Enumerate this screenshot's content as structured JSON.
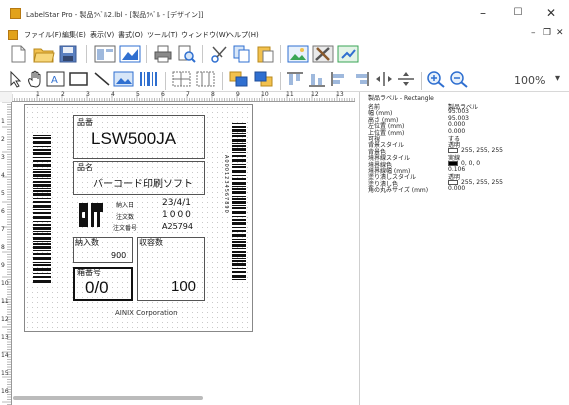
{
  "window": {
    "title": "LabelStar Pro - 製品ﾗﾍﾞﾙ2.lbl - [製品ﾗﾍﾞﾙ - [デザイン]]",
    "minimize": "–",
    "maximize": "☐",
    "close": "✕"
  },
  "menu": {
    "items": [
      "ファイル(F)",
      "編集(E)",
      "表示(V)",
      "書式(O)",
      "ツール(T)",
      "ウィンドウ(W)",
      "ヘルプ(H)"
    ],
    "mdi_min": "–",
    "mdi_restore": "❐",
    "mdi_close": "✕"
  },
  "toolbar": {
    "zoom": "100%",
    "zoom_arrow": "▾"
  },
  "rulers": {
    "h_numbers": [
      "1",
      "2",
      "3",
      "4",
      "5",
      "6",
      "7",
      "8",
      "9",
      "10",
      "11",
      "12",
      "13"
    ],
    "v_numbers": [
      "1",
      "2",
      "3",
      "4",
      "5",
      "6",
      "7",
      "8",
      "9",
      "10",
      "11",
      "12",
      "13",
      "14",
      "15",
      "16"
    ]
  },
  "label": {
    "hinban_label": "品番",
    "hinban_value": "LSW500JA",
    "hinmei_label": "品名",
    "hinmei_value": "バーコード印刷ソフト",
    "nyuka_label": "納入日",
    "nyuka_value": "23/4/1",
    "chumon_label": "注文数",
    "chumon_value": "1000",
    "chumon_no_label": "注文番号",
    "chumon_no_value": "A25794",
    "nounyu_label": "納入数",
    "nounyu_value": "900",
    "shuyou_label": "収容数",
    "shuyou_value": "100",
    "hako_label": "箱番号",
    "hako_value": "0/0",
    "company": "AINIX Corporation",
    "vbarcode_text": "A0001234567890"
  },
  "properties": {
    "title": "製品ラベル - Rectangle",
    "rows": [
      {
        "k": "名前",
        "v": "製品ラベル"
      },
      {
        "k": "幅 (mm)",
        "v": "95.003"
      },
      {
        "k": "高さ (mm)",
        "v": "95.003"
      },
      {
        "k": "左位置 (mm)",
        "v": "0.000"
      },
      {
        "k": "上位置 (mm)",
        "v": "0.000"
      },
      {
        "k": "可視",
        "v": "する"
      },
      {
        "k": "背景スタイル",
        "v": "透明"
      },
      {
        "k": "背景色",
        "v": "255, 255, 255"
      },
      {
        "k": "境界線スタイル",
        "v": "実線"
      },
      {
        "k": "境界線色",
        "v": "0, 0, 0"
      },
      {
        "k": "境界線幅 (mm)",
        "v": "0.106"
      },
      {
        "k": "塗り潰しスタイル",
        "v": "透明"
      },
      {
        "k": "塗り潰し色",
        "v": "255, 255, 255"
      },
      {
        "k": "角の丸みサイズ (mm)",
        "v": "0.000"
      }
    ]
  },
  "colors": {
    "accent": "#2f6fd0",
    "folder": "#f2c14e",
    "chart_green": "#3aa655"
  }
}
